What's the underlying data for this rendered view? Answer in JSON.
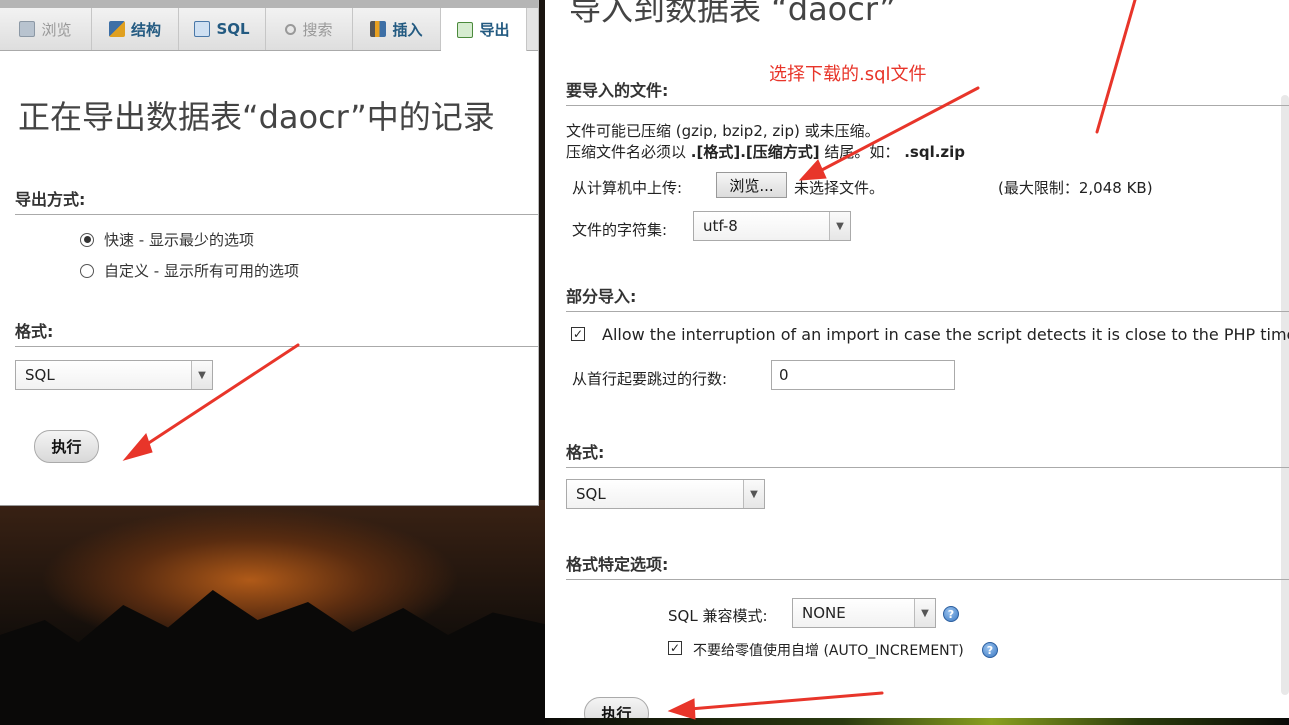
{
  "left": {
    "tabs": [
      {
        "label": "浏览",
        "icon": "browse-icon",
        "dim": true
      },
      {
        "label": "结构",
        "icon": "structure-icon",
        "dim": false
      },
      {
        "label": "SQL",
        "icon": "sql-icon",
        "dim": false
      },
      {
        "label": "搜索",
        "icon": "search-icon",
        "dim": true
      },
      {
        "label": "插入",
        "icon": "insert-icon",
        "dim": false
      },
      {
        "label": "导出",
        "icon": "export-icon",
        "dim": false,
        "active": true
      }
    ],
    "title": "正在导出数据表“daocr”中的记录",
    "export_method_heading": "导出方式:",
    "option_quick": "快速 - 显示最少的选项",
    "option_custom": "自定义 - 显示所有可用的选项",
    "quick_selected": true,
    "format_heading": "格式:",
    "format_value": "SQL",
    "go_label": "执行"
  },
  "right": {
    "title": "导入到数据表 “daocr”",
    "annotation": "选择下载的.sql文件",
    "file_heading": "要导入的文件:",
    "compress_note": "文件可能已压缩 (gzip, bzip2, zip) 或未压缩。",
    "compress_rule_prefix": "压缩文件名必须以",
    "compress_rule_bold": ".[格式].[压缩方式]",
    "compress_rule_suffix": "结尾。如：",
    "compress_example": ".sql.zip",
    "upload_label": "从计算机中上传:",
    "browse_label": "浏览...",
    "no_file": "未选择文件。",
    "max_limit": "(最大限制：2,048 KB)",
    "charset_label": "文件的字符集:",
    "charset_value": "utf-8",
    "partial_heading": "部分导入:",
    "allow_interrupt": "Allow the interruption of an import in case the script detects it is close to the PHP timeout",
    "allow_interrupt_checked": true,
    "skip_rows_label": "从首行起要跳过的行数:",
    "skip_rows_value": "0",
    "format_heading": "格式:",
    "format_value": "SQL",
    "format_options_heading": "格式特定选项:",
    "sql_compat_label": "SQL 兼容模式:",
    "sql_compat_value": "NONE",
    "no_auto_inc_label": "不要给零值使用自增 (AUTO_INCREMENT)",
    "no_auto_inc_checked": true,
    "go_label": "执行"
  },
  "colors": {
    "annotation_red": "#e8352a",
    "tab_text": "#235a81"
  }
}
